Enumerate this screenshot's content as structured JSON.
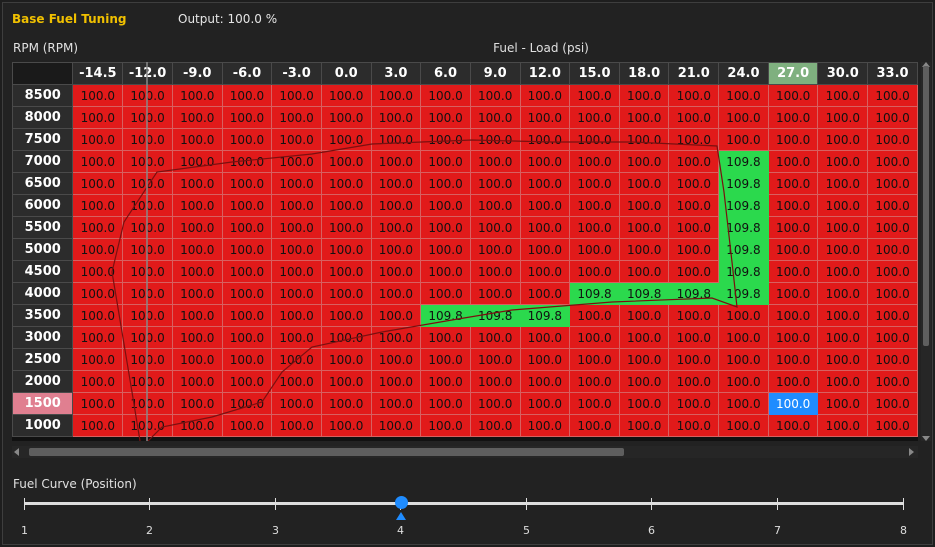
{
  "header": {
    "title": "Base Fuel Tuning",
    "output": "Output: 100.0 %"
  },
  "axes": {
    "y_label": "RPM (RPM)",
    "x_label": "Fuel - Load (psi)"
  },
  "table": {
    "columns": [
      "-14.5",
      "-12.0",
      "-9.0",
      "-6.0",
      "-3.0",
      "0.0",
      "3.0",
      "6.0",
      "9.0",
      "12.0",
      "15.0",
      "18.0",
      "21.0",
      "24.0",
      "27.0",
      "30.0",
      "33.0"
    ],
    "active_column": "27.0",
    "active_row": "1500",
    "rows": [
      {
        "rpm": "8500",
        "cells": [
          "100.0",
          "100.0",
          "100.0",
          "100.0",
          "100.0",
          "100.0",
          "100.0",
          "100.0",
          "100.0",
          "100.0",
          "100.0",
          "100.0",
          "100.0",
          "100.0",
          "100.0",
          "100.0",
          "100.0"
        ]
      },
      {
        "rpm": "8000",
        "cells": [
          "100.0",
          "100.0",
          "100.0",
          "100.0",
          "100.0",
          "100.0",
          "100.0",
          "100.0",
          "100.0",
          "100.0",
          "100.0",
          "100.0",
          "100.0",
          "100.0",
          "100.0",
          "100.0",
          "100.0"
        ]
      },
      {
        "rpm": "7500",
        "cells": [
          "100.0",
          "100.0",
          "100.0",
          "100.0",
          "100.0",
          "100.0",
          "100.0",
          "100.0",
          "100.0",
          "100.0",
          "100.0",
          "100.0",
          "100.0",
          "100.0",
          "100.0",
          "100.0",
          "100.0"
        ]
      },
      {
        "rpm": "7000",
        "cells": [
          "100.0",
          "100.0",
          "100.0",
          "100.0",
          "100.0",
          "100.0",
          "100.0",
          "100.0",
          "100.0",
          "100.0",
          "100.0",
          "100.0",
          "100.0",
          "109.8",
          "100.0",
          "100.0",
          "100.0"
        ]
      },
      {
        "rpm": "6500",
        "cells": [
          "100.0",
          "100.0",
          "100.0",
          "100.0",
          "100.0",
          "100.0",
          "100.0",
          "100.0",
          "100.0",
          "100.0",
          "100.0",
          "100.0",
          "100.0",
          "109.8",
          "100.0",
          "100.0",
          "100.0"
        ]
      },
      {
        "rpm": "6000",
        "cells": [
          "100.0",
          "100.0",
          "100.0",
          "100.0",
          "100.0",
          "100.0",
          "100.0",
          "100.0",
          "100.0",
          "100.0",
          "100.0",
          "100.0",
          "100.0",
          "109.8",
          "100.0",
          "100.0",
          "100.0"
        ]
      },
      {
        "rpm": "5500",
        "cells": [
          "100.0",
          "100.0",
          "100.0",
          "100.0",
          "100.0",
          "100.0",
          "100.0",
          "100.0",
          "100.0",
          "100.0",
          "100.0",
          "100.0",
          "100.0",
          "109.8",
          "100.0",
          "100.0",
          "100.0"
        ]
      },
      {
        "rpm": "5000",
        "cells": [
          "100.0",
          "100.0",
          "100.0",
          "100.0",
          "100.0",
          "100.0",
          "100.0",
          "100.0",
          "100.0",
          "100.0",
          "100.0",
          "100.0",
          "100.0",
          "109.8",
          "100.0",
          "100.0",
          "100.0"
        ]
      },
      {
        "rpm": "4500",
        "cells": [
          "100.0",
          "100.0",
          "100.0",
          "100.0",
          "100.0",
          "100.0",
          "100.0",
          "100.0",
          "100.0",
          "100.0",
          "100.0",
          "100.0",
          "100.0",
          "109.8",
          "100.0",
          "100.0",
          "100.0"
        ]
      },
      {
        "rpm": "4000",
        "cells": [
          "100.0",
          "100.0",
          "100.0",
          "100.0",
          "100.0",
          "100.0",
          "100.0",
          "100.0",
          "100.0",
          "100.0",
          "109.8",
          "109.8",
          "109.8",
          "109.8",
          "100.0",
          "100.0",
          "100.0"
        ]
      },
      {
        "rpm": "3500",
        "cells": [
          "100.0",
          "100.0",
          "100.0",
          "100.0",
          "100.0",
          "100.0",
          "100.0",
          "109.8",
          "109.8",
          "109.8",
          "100.0",
          "100.0",
          "100.0",
          "100.0",
          "100.0",
          "100.0",
          "100.0"
        ]
      },
      {
        "rpm": "3000",
        "cells": [
          "100.0",
          "100.0",
          "100.0",
          "100.0",
          "100.0",
          "100.0",
          "100.0",
          "100.0",
          "100.0",
          "100.0",
          "100.0",
          "100.0",
          "100.0",
          "100.0",
          "100.0",
          "100.0",
          "100.0"
        ]
      },
      {
        "rpm": "2500",
        "cells": [
          "100.0",
          "100.0",
          "100.0",
          "100.0",
          "100.0",
          "100.0",
          "100.0",
          "100.0",
          "100.0",
          "100.0",
          "100.0",
          "100.0",
          "100.0",
          "100.0",
          "100.0",
          "100.0",
          "100.0"
        ]
      },
      {
        "rpm": "2000",
        "cells": [
          "100.0",
          "100.0",
          "100.0",
          "100.0",
          "100.0",
          "100.0",
          "100.0",
          "100.0",
          "100.0",
          "100.0",
          "100.0",
          "100.0",
          "100.0",
          "100.0",
          "100.0",
          "100.0",
          "100.0"
        ]
      },
      {
        "rpm": "1500",
        "cells": [
          "100.0",
          "100.0",
          "100.0",
          "100.0",
          "100.0",
          "100.0",
          "100.0",
          "100.0",
          "100.0",
          "100.0",
          "100.0",
          "100.0",
          "100.0",
          "100.0",
          "100.0",
          "100.0",
          "100.0"
        ]
      },
      {
        "rpm": "1000",
        "cells": [
          "100.0",
          "100.0",
          "100.0",
          "100.0",
          "100.0",
          "100.0",
          "100.0",
          "100.0",
          "100.0",
          "100.0",
          "100.0",
          "100.0",
          "100.0",
          "100.0",
          "100.0",
          "100.0",
          "100.0"
        ]
      }
    ],
    "highlight_value": "109.8",
    "current_cell": {
      "row": "1500",
      "col": "27.0"
    }
  },
  "curve": {
    "label": "Fuel Curve  (Position)",
    "ticks": [
      "1",
      "2",
      "3",
      "4",
      "5",
      "6",
      "7",
      "8"
    ],
    "value": "4"
  },
  "colors": {
    "cell_default": "#e11a1a",
    "cell_highlight": "#2bd94d",
    "cell_current": "#1f8cff",
    "title": "#f0c000"
  },
  "icons": {
    "scroll_up": "triangle-up-icon",
    "scroll_down": "triangle-down-icon",
    "scroll_left": "triangle-left-icon",
    "scroll_right": "triangle-right-icon"
  }
}
